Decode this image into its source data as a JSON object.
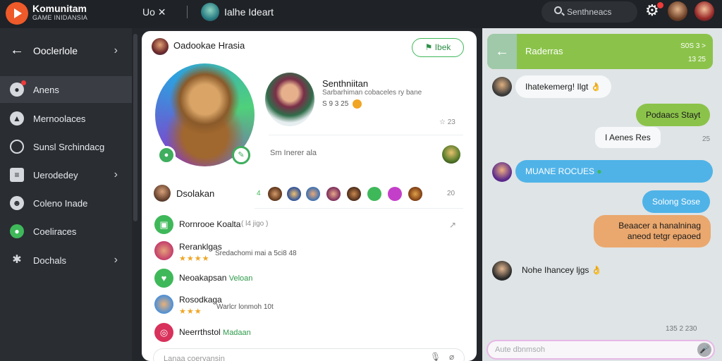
{
  "app": {
    "title": "Komunitam",
    "subtitle": "GAME INIDANSIA"
  },
  "window_controls": "Uo ✕",
  "channel": {
    "title": "Ialhe Ideart"
  },
  "search": {
    "placeholder": "Senthneacs"
  },
  "sidebar": {
    "header": "Ooclerlole",
    "items": [
      {
        "label": "Anens",
        "icon": "chat-bubble-icon",
        "active": true,
        "badge": true
      },
      {
        "label": "Mernoolaces",
        "icon": "people-icon"
      },
      {
        "label": "Sunsl Srchindacg",
        "icon": "target-icon"
      },
      {
        "label": "Uerodedey",
        "icon": "list-icon",
        "chevron": true
      },
      {
        "label": "Coleno Inade",
        "icon": "person-icon"
      },
      {
        "label": "Coeliraces",
        "icon": "chat-icon"
      },
      {
        "label": "Dochals",
        "icon": "gear-icon",
        "chevron": true
      }
    ]
  },
  "profile": {
    "header_title": "Oadookae Hrasia",
    "header_button": "Ibek",
    "name": "Senthniitan",
    "subtitle": "Sarbarhiman cobaceles ry bane",
    "stats": "S 9 3 25",
    "star_count": "23",
    "online_label": "Sm Inerer ala",
    "party_name": "Dsolakan",
    "party_count": "4",
    "party_more": "20",
    "rows": [
      {
        "title": "Rornrooe Koalta",
        "extra": "( l4 jigo )",
        "color": "#3fb85a",
        "icon": "calendar-icon"
      },
      {
        "title": "Reranklgas",
        "detail": "Sredachomi mai a 5ci8 48",
        "stars": "★★★★",
        "color": "#c33c6a",
        "icon": "avatar"
      },
      {
        "title": "Neoakapsan",
        "green": "Veloan",
        "color": "#3fb85a",
        "icon": "heart-icon"
      },
      {
        "title": "Rosodkaga",
        "detail": "Warlcr lonmoh 10t",
        "stars": "★★★",
        "color": "#4a8fd8",
        "icon": "avatar"
      },
      {
        "title": "Neerrthstol",
        "green": "Madaan",
        "color": "#d8315b",
        "icon": "target-icon"
      }
    ],
    "compose_placeholder": "Lanaa coeryansin"
  },
  "chat": {
    "title": "Raderras",
    "meta_top": "S0S 3 >",
    "meta_bottom": "13 25",
    "messages": [
      {
        "text": "Ihatekemerg! Ilgt 👌",
        "side": "left",
        "style": "white"
      },
      {
        "text": "Podaacs Stayt",
        "side": "right",
        "style": "green"
      },
      {
        "text": "I Aenes Res",
        "side": "right",
        "style": "white",
        "meta": "25"
      },
      {
        "text": "MUANE ROCUES",
        "side": "left",
        "style": "blue"
      },
      {
        "text": "Solong Sose",
        "side": "right",
        "style": "blue"
      },
      {
        "text": "Beaacer a hanalninag aneod tetgr epaoed",
        "side": "right",
        "style": "orange"
      },
      {
        "text": "Nohe Ihancey ljgs 👌",
        "side": "left",
        "style": "plain"
      }
    ],
    "time": "135  2 230",
    "input_placeholder": "Aute dbnmsoh"
  },
  "colors": {
    "accent_green": "#3fb85a",
    "chat_green": "#8bc34a",
    "chat_blue": "#4fb3e8",
    "chat_orange": "#eaa86e",
    "sidebar": "#2a2d32"
  }
}
